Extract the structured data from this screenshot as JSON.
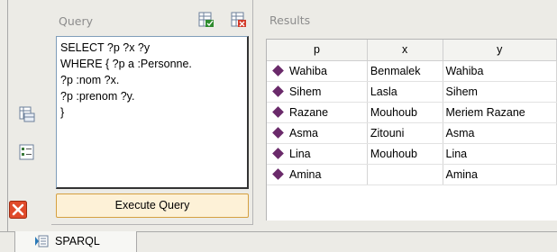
{
  "query_panel": {
    "title": "Query",
    "icons": [
      "spreadsheet-green-icon",
      "spreadsheet-red-icon"
    ],
    "query_text": "SELECT ?p ?x ?y\nWHERE { ?p a :Personne.\n?p :nom ?x.\n?p :prenom ?y.\n}",
    "execute_label": "Execute Query"
  },
  "sidebar": {
    "icons": [
      "table-icon",
      "list-icon",
      "close-icon"
    ],
    "close_color": "#e04a2a"
  },
  "results": {
    "title": "Results",
    "columns": [
      "p",
      "x",
      "y"
    ],
    "rows": [
      [
        "Wahiba",
        "Benmalek",
        "Wahiba"
      ],
      [
        "Sihem",
        "Lasla",
        "Sihem"
      ],
      [
        "Razane",
        "Mouhoub",
        "Meriem Razane"
      ],
      [
        "Asma",
        "Zitouni",
        "Asma"
      ],
      [
        "Lina",
        "Mouhoub",
        "Lina"
      ],
      [
        "Amina",
        "",
        "Amina"
      ]
    ],
    "individual_icon_color": "#6a2a6a"
  },
  "bottom_tab": {
    "label": "SPARQL",
    "icon": "sparql-tab-icon"
  }
}
